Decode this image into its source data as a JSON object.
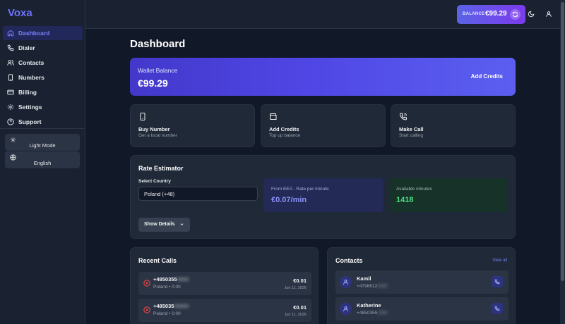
{
  "sidebar": {
    "brand": "Voxa",
    "items": [
      {
        "label": "Dashboard",
        "icon": "home-icon",
        "active": true
      },
      {
        "label": "Dialer",
        "icon": "phone-icon"
      },
      {
        "label": "Contacts",
        "icon": "users-icon"
      },
      {
        "label": "Numbers",
        "icon": "smartphone-icon"
      },
      {
        "label": "Billing",
        "icon": "credit-card-icon"
      },
      {
        "label": "Settings",
        "icon": "gear-icon"
      },
      {
        "label": "Support",
        "icon": "help-circle-icon"
      }
    ],
    "theme_label": "Light Mode",
    "language_label": "English"
  },
  "topbar": {
    "balance_label": "BALANCE",
    "balance_value": "€99.29"
  },
  "page": {
    "title": "Dashboard"
  },
  "wallet": {
    "label": "Wallet Balance",
    "value": "€99.29",
    "add_credits": "Add Credits"
  },
  "actions": [
    {
      "title": "Buy Number",
      "subtitle": "Get a local number",
      "icon": "smartphone-icon"
    },
    {
      "title": "Add Credits",
      "subtitle": "Top up balance",
      "icon": "wallet-icon"
    },
    {
      "title": "Make Call",
      "subtitle": "Start calling",
      "icon": "phone-call-icon"
    }
  ],
  "rate": {
    "title": "Rate Estimator",
    "country_label": "Select Country",
    "country_value": "Poland (+48)",
    "from_label": "From EEA - Rate per minute",
    "from_value": "€0.07/min",
    "minutes_label": "Available minutes",
    "minutes_value": "1418",
    "details_label": "Show Details"
  },
  "recent_calls": {
    "title": "Recent Calls",
    "rows": [
      {
        "number": "+4850355",
        "hidden": "0000",
        "meta": "Poland • 0:00",
        "cost": "€0.01",
        "date": "Jun 11, 2026"
      },
      {
        "number": "+485035",
        "hidden": "00000",
        "meta": "Poland • 0:00",
        "cost": "€0.01",
        "date": "Jun 11, 2026"
      }
    ]
  },
  "contacts": {
    "title": "Contacts",
    "view_all": "View all",
    "rows": [
      {
        "name": "Kamil",
        "phone": "+4796812",
        "hidden": "0000"
      },
      {
        "name": "Katherine",
        "phone": "+4850355",
        "hidden": "1000"
      }
    ]
  },
  "colors": {
    "accent": "#6d71ff",
    "background": "#111827",
    "card": "#1f2937",
    "success": "#4ade80",
    "danger": "#ef4444"
  }
}
